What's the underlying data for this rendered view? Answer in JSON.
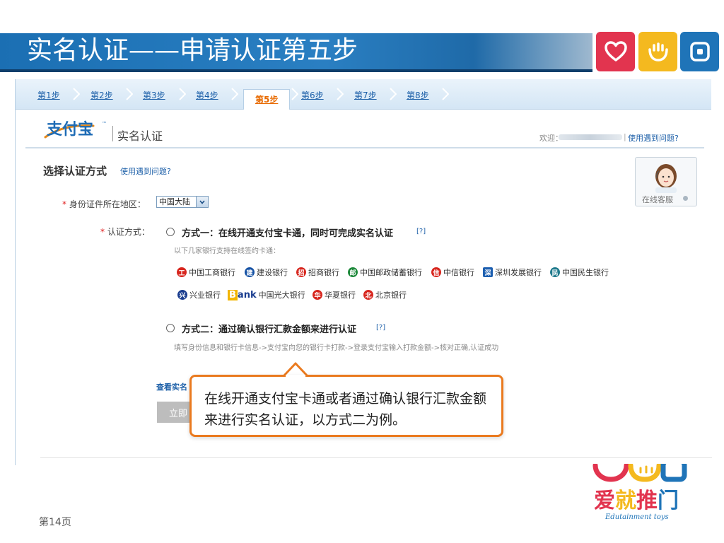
{
  "slide": {
    "title": "实名认证——申请认证第五步",
    "page_label": "第14页"
  },
  "brand_tiles": [
    {
      "icon": "heart-icon",
      "color": "#e2344f"
    },
    {
      "icon": "hand-icon",
      "color": "#f4b91f"
    },
    {
      "icon": "square-icon",
      "color": "#1f74b8"
    }
  ],
  "steps": [
    "第1步",
    "第2步",
    "第3步",
    "第4步",
    "第5步",
    "第6步",
    "第7步",
    "第8步"
  ],
  "active_step_index": 4,
  "header": {
    "logo_text": "支付宝",
    "logo_trademark": "™",
    "subtitle": "实名认证",
    "welcome": "欢迎：",
    "separator": "|",
    "help_link": "使用遇到问题?"
  },
  "section": {
    "title": "选择认证方式",
    "help_link": "使用遇到问题?"
  },
  "customer_service": {
    "label": "在线客服"
  },
  "form": {
    "region_label": "身份证件所在地区：",
    "region_value": "中国大陆",
    "method_label": "认证方式：",
    "required_mark": "*"
  },
  "option1": {
    "title": "方式一：在线开通支付宝卡通，同时可完成实名认证",
    "help": "[?]",
    "desc": "以下几家银行支持在线签约卡通："
  },
  "banks_row1": [
    {
      "name": "中国工商银行",
      "icon": "icbc-icon",
      "color": "#d7261e"
    },
    {
      "name": "建设银行",
      "icon": "ccb-icon",
      "color": "#1451a4"
    },
    {
      "name": "招商银行",
      "icon": "cmb-icon",
      "color": "#d7261e"
    },
    {
      "name": "中国邮政储蓄银行",
      "icon": "psbc-icon",
      "color": "#1f8a3c"
    },
    {
      "name": "中信银行",
      "icon": "citic-icon",
      "color": "#d7261e"
    },
    {
      "name": "深圳发展银行",
      "icon": "sdb-icon",
      "color": "#1d5fb0"
    },
    {
      "name": "中国民生银行",
      "icon": "cmbc-icon",
      "color": "#1f7a8c"
    }
  ],
  "banks_row2": [
    {
      "name": "兴业银行",
      "icon": "cib-icon",
      "color": "#1a3d8f"
    },
    {
      "name": "中国光大银行",
      "icon": "ceb-icon",
      "color": "#f2b500",
      "logo_prefix": "B",
      "logo_word": "ank"
    },
    {
      "name": "华夏银行",
      "icon": "hxb-icon",
      "color": "#d7261e"
    },
    {
      "name": "北京银行",
      "icon": "bob-icon",
      "color": "#d7261e"
    }
  ],
  "option2": {
    "title": "方式二：通过确认银行汇款金额来进行认证",
    "help": "[?]",
    "desc": "填写身份信息和银行卡信息->支付宝向您的银行卡打款->登录支付宝输入打款金额->核对正确,认证成功"
  },
  "more_link": "查看实名",
  "submit_button": "立即",
  "callout": {
    "line1": "在线开通支付宝卡通或者通过确认银行汇款金额",
    "line2": "来进行实名认证，以方式二为例。",
    "border_color": "#ea7a1f"
  },
  "brand_logo": {
    "text": "爱就推门",
    "tagline": "Edutainment toys"
  }
}
